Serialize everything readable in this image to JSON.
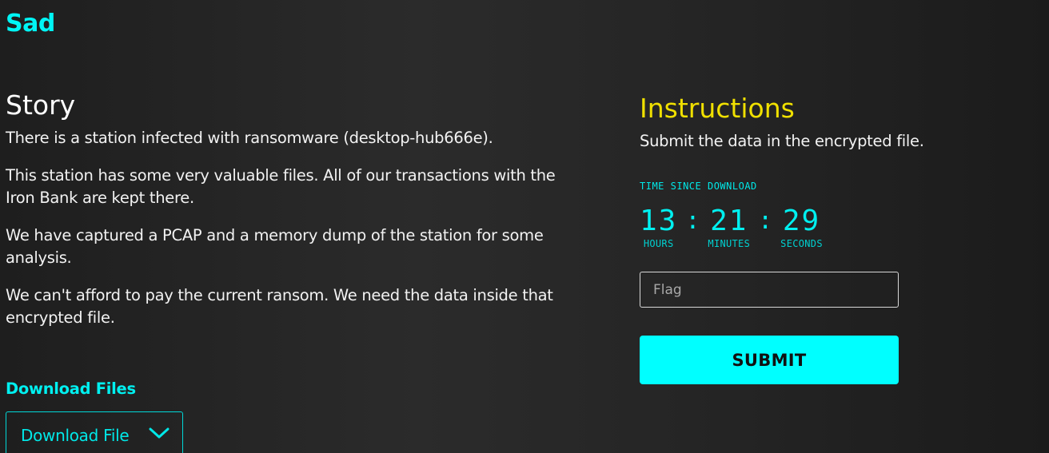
{
  "page": {
    "title": "Sad"
  },
  "story": {
    "heading": "Story",
    "paragraphs": [
      "There is a station infected with ransomware (desktop-hub666e).",
      "This station has some very valuable files. All of our transactions with the Iron Bank are kept there.",
      "We have captured a PCAP and a memory dump of the station for some analysis.",
      "We can't afford to pay the current ransom. We need the data inside that encrypted file."
    ]
  },
  "downloads": {
    "heading": "Download Files",
    "dropdown_label": "Download File",
    "icon": "chevron-down-icon"
  },
  "instructions": {
    "heading": "Instructions",
    "text": "Submit the data in the encrypted file."
  },
  "timer": {
    "caption": "TIME SINCE DOWNLOAD",
    "hours": "13",
    "minutes": "21",
    "seconds": "29",
    "separator": ":",
    "hours_label": "HOURS",
    "minutes_label": "MINUTES",
    "seconds_label": "SECONDS"
  },
  "form": {
    "flag_placeholder": "Flag",
    "flag_value": "",
    "submit_label": "SUBMIT"
  },
  "colors": {
    "accent": "#00ffff",
    "heading_yellow": "#f0e000",
    "background": "#242424"
  }
}
